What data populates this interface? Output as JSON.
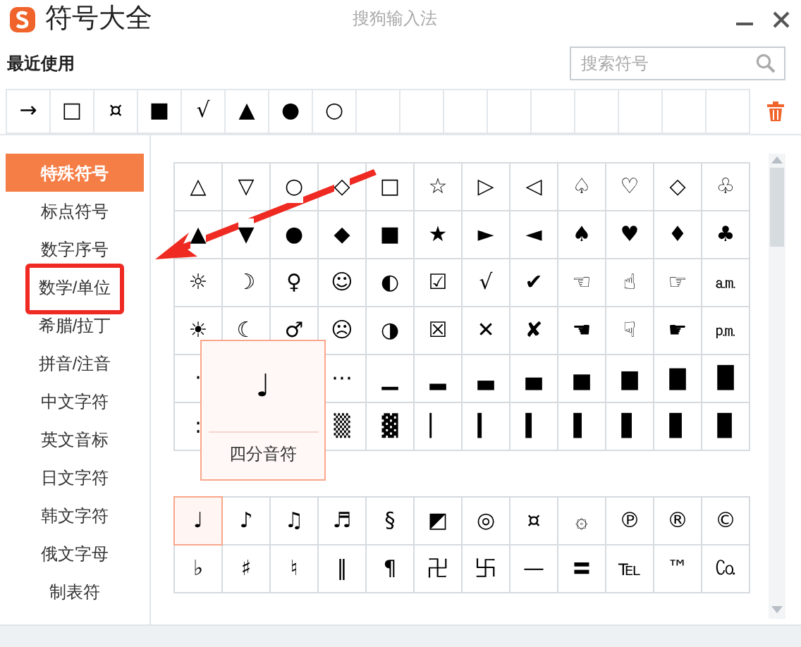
{
  "window": {
    "title": "符号大全",
    "app_name": "搜狗输入法"
  },
  "recent": {
    "label": "最近使用",
    "symbols": [
      "→",
      "□",
      "¤",
      "■",
      "√",
      "▲",
      "●",
      "○"
    ]
  },
  "search": {
    "placeholder": "搜索符号"
  },
  "sidebar": {
    "items": [
      {
        "label": "特殊符号",
        "selected": true
      },
      {
        "label": "标点符号",
        "selected": false
      },
      {
        "label": "数字序号",
        "selected": false
      },
      {
        "label": "数学/单位",
        "selected": false
      },
      {
        "label": "希腊/拉丁",
        "selected": false
      },
      {
        "label": "拼音/注音",
        "selected": false
      },
      {
        "label": "中文字符",
        "selected": false
      },
      {
        "label": "英文音标",
        "selected": false
      },
      {
        "label": "日文字符",
        "selected": false
      },
      {
        "label": "韩文字符",
        "selected": false
      },
      {
        "label": "俄文字母",
        "selected": false
      },
      {
        "label": "制表符",
        "selected": false
      }
    ]
  },
  "sections": [
    {
      "rows": [
        [
          {
            "symbol": "△",
            "selected": false
          },
          {
            "symbol": "▽",
            "selected": false
          },
          {
            "symbol": "○",
            "selected": false
          },
          {
            "symbol": "◇",
            "selected": false
          },
          {
            "symbol": "□",
            "selected": false
          },
          {
            "symbol": "☆",
            "selected": false
          },
          {
            "symbol": "▷",
            "selected": false
          },
          {
            "symbol": "◁",
            "selected": false
          },
          {
            "symbol": "♤",
            "selected": false
          },
          {
            "symbol": "♡",
            "selected": false
          },
          {
            "symbol": "◇",
            "selected": false
          },
          {
            "symbol": "♧",
            "selected": false
          }
        ],
        [
          {
            "symbol": "▲",
            "selected": false
          },
          {
            "symbol": "▼",
            "selected": false
          },
          {
            "symbol": "●",
            "selected": false
          },
          {
            "symbol": "◆",
            "selected": false
          },
          {
            "symbol": "■",
            "selected": false
          },
          {
            "symbol": "★",
            "selected": false
          },
          {
            "symbol": "►",
            "selected": false
          },
          {
            "symbol": "◄",
            "selected": false
          },
          {
            "symbol": "♠",
            "selected": false
          },
          {
            "symbol": "♥",
            "selected": false
          },
          {
            "symbol": "♦",
            "selected": false
          },
          {
            "symbol": "♣",
            "selected": false
          }
        ],
        [
          {
            "symbol": "☼",
            "selected": false
          },
          {
            "symbol": "☽",
            "selected": false
          },
          {
            "symbol": "♀",
            "selected": false
          },
          {
            "symbol": "☺",
            "selected": false
          },
          {
            "symbol": "◐",
            "selected": false
          },
          {
            "symbol": "☑",
            "selected": false
          },
          {
            "symbol": "√",
            "selected": false
          },
          {
            "symbol": "✔",
            "selected": false
          },
          {
            "symbol": "☜",
            "selected": false
          },
          {
            "symbol": "☝",
            "selected": false
          },
          {
            "symbol": "☞",
            "selected": false
          },
          {
            "symbol": "㏂",
            "selected": false
          }
        ],
        [
          {
            "symbol": "☀",
            "selected": false
          },
          {
            "symbol": "☾",
            "selected": false
          },
          {
            "symbol": "♂",
            "selected": false
          },
          {
            "symbol": "☹",
            "selected": false
          },
          {
            "symbol": "◑",
            "selected": false
          },
          {
            "symbol": "☒",
            "selected": false
          },
          {
            "symbol": "✕",
            "selected": false
          },
          {
            "symbol": "✘",
            "selected": false
          },
          {
            "symbol": "☚",
            "selected": false
          },
          {
            "symbol": "☟",
            "selected": false
          },
          {
            "symbol": "☛",
            "selected": false
          },
          {
            "symbol": "㏘",
            "selected": false
          }
        ],
        [
          {
            "symbol": "·",
            "selected": false
          },
          null,
          null,
          {
            "symbol": "⋯",
            "selected": false
          },
          {
            "symbol": "▁",
            "selected": false
          },
          {
            "symbol": "▂",
            "selected": false
          },
          {
            "symbol": "▃",
            "selected": false
          },
          {
            "symbol": "▄",
            "selected": false
          },
          {
            "symbol": "▅",
            "selected": false
          },
          {
            "symbol": "▆",
            "selected": false
          },
          {
            "symbol": "▇",
            "selected": false
          },
          {
            "symbol": "█",
            "selected": false
          }
        ],
        [
          {
            "symbol": ":",
            "selected": false
          },
          null,
          null,
          {
            "symbol": "▒",
            "selected": false
          },
          {
            "symbol": "▓",
            "selected": false
          },
          {
            "symbol": "▏",
            "selected": false
          },
          {
            "symbol": "▎",
            "selected": false
          },
          {
            "symbol": "▍",
            "selected": false
          },
          {
            "symbol": "▌",
            "selected": false
          },
          {
            "symbol": "▋",
            "selected": false
          },
          {
            "symbol": "▊",
            "selected": false
          },
          {
            "symbol": "▉",
            "selected": false
          }
        ]
      ]
    },
    {
      "rows": [
        [
          {
            "symbol": "♩",
            "selected": true
          },
          {
            "symbol": "♪",
            "selected": false
          },
          {
            "symbol": "♫",
            "selected": false
          },
          {
            "symbol": "♬",
            "selected": false
          },
          {
            "symbol": "§",
            "selected": false
          },
          {
            "symbol": "◩",
            "selected": false
          },
          {
            "symbol": "◎",
            "selected": false
          },
          {
            "symbol": "¤",
            "selected": false
          },
          {
            "symbol": "۞",
            "selected": false
          },
          {
            "symbol": "℗",
            "selected": false
          },
          {
            "symbol": "®",
            "selected": false
          },
          {
            "symbol": "©",
            "selected": false
          }
        ],
        [
          {
            "symbol": "♭",
            "selected": false
          },
          {
            "symbol": "♯",
            "selected": false
          },
          {
            "symbol": "♮",
            "selected": false
          },
          {
            "symbol": "‖",
            "selected": false
          },
          {
            "symbol": "¶",
            "selected": false
          },
          {
            "symbol": "卍",
            "selected": false
          },
          {
            "symbol": "卐",
            "selected": false
          },
          {
            "symbol": "—",
            "selected": false
          },
          {
            "symbol": "〓",
            "selected": false
          },
          {
            "symbol": "℡",
            "selected": false
          },
          {
            "symbol": "™",
            "selected": false
          },
          {
            "symbol": "㏇",
            "selected": false
          }
        ]
      ]
    }
  ],
  "tooltip": {
    "symbol": "♩",
    "name": "四分音符"
  }
}
